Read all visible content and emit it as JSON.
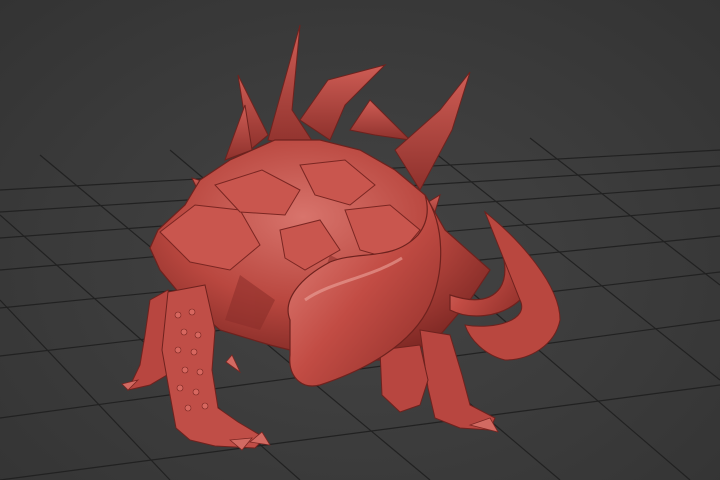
{
  "viewport": {
    "background_color": "#3b3b3b",
    "grid_color": "#202020",
    "grid_visible": true
  },
  "model": {
    "subject": "spiked-horned-creature",
    "material_color": "#c0504a",
    "shadow_color": "#7a2622",
    "highlight_color": "#e0827a"
  }
}
